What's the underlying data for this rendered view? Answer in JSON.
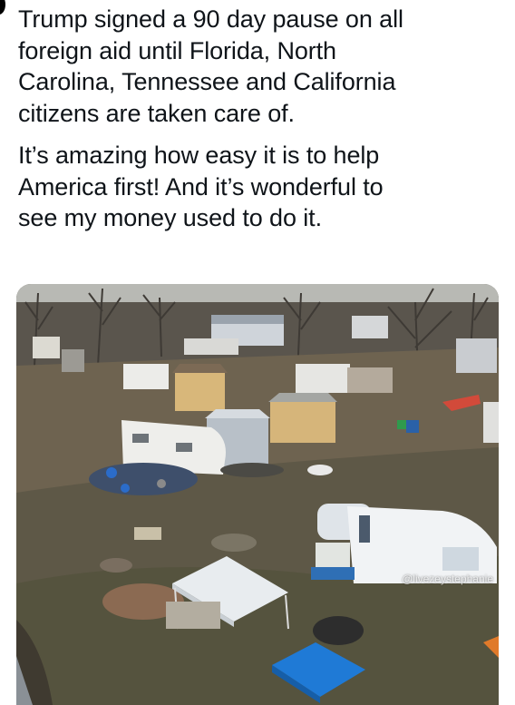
{
  "post": {
    "paragraphs": [
      "Trump signed a 90 day pause on all\nforeign aid until Florida, North\nCarolina, Tennessee and California\ncitizens are taken care of.",
      "It’s amazing how easy it is to help\nAmerica first! And it’s wonderful to\nsee my money used to do it."
    ]
  },
  "media": {
    "watermark": "@livezeystephanie",
    "colors": {
      "sky": "#b8b9b4",
      "ground": "#6e6350",
      "trees": "#4a4640",
      "tent_white": "#e8ecef",
      "tent_blue": "#1f7ad6"
    }
  }
}
